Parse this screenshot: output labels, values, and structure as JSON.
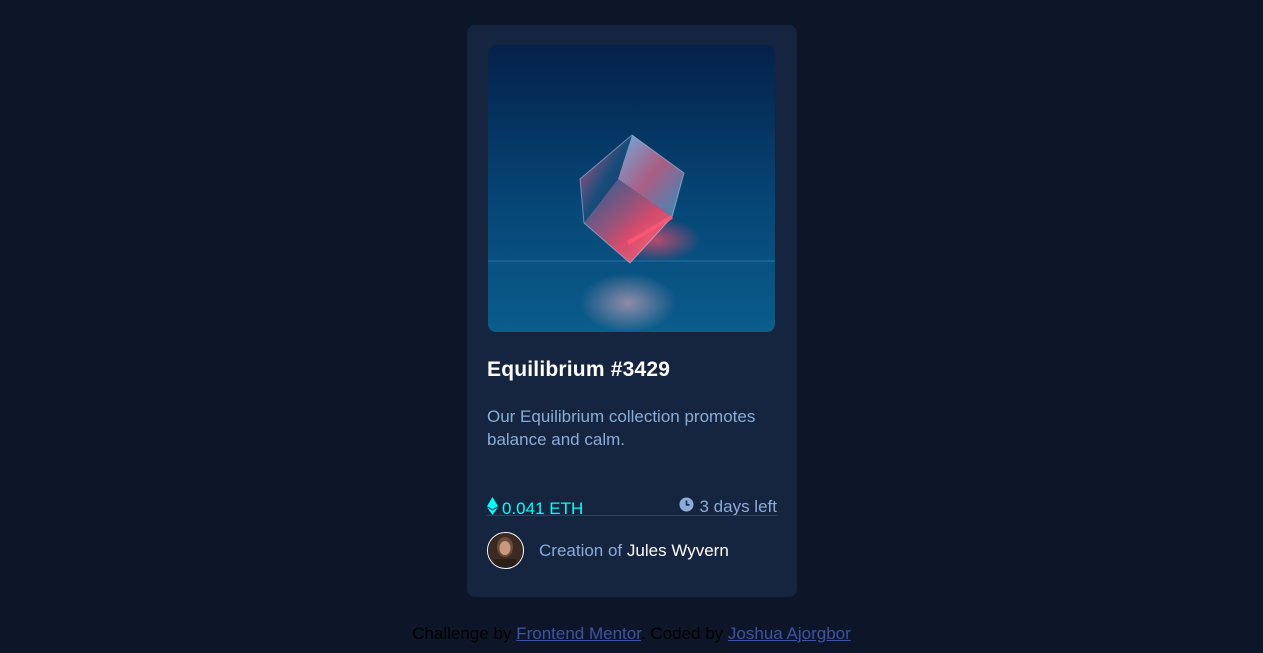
{
  "card": {
    "title": "Equilibrium #3429",
    "description": "Our Equilibrium collection promotes balance and calm.",
    "price": "0.041 ETH",
    "time_left": "3 days left",
    "creator_prefix": "Creation of",
    "creator_name": "Jules Wyvern",
    "hero_image_alt": "equilibrium-cube"
  },
  "attribution": {
    "challenge_text": "Challenge by",
    "challenge_link": "Frontend Mentor",
    "separator": ".",
    "coded_text": "Coded by",
    "coded_link": "Joshua Ajorgbor"
  },
  "colors": {
    "page_bg": "#0d1628",
    "card_bg": "#15253f",
    "cyan": "#00fff8",
    "soft_blue": "#8bacd9",
    "white": "#ffffff",
    "link": "#3e52a3"
  },
  "icons": {
    "price": "ethereum-icon",
    "time": "clock-icon"
  }
}
